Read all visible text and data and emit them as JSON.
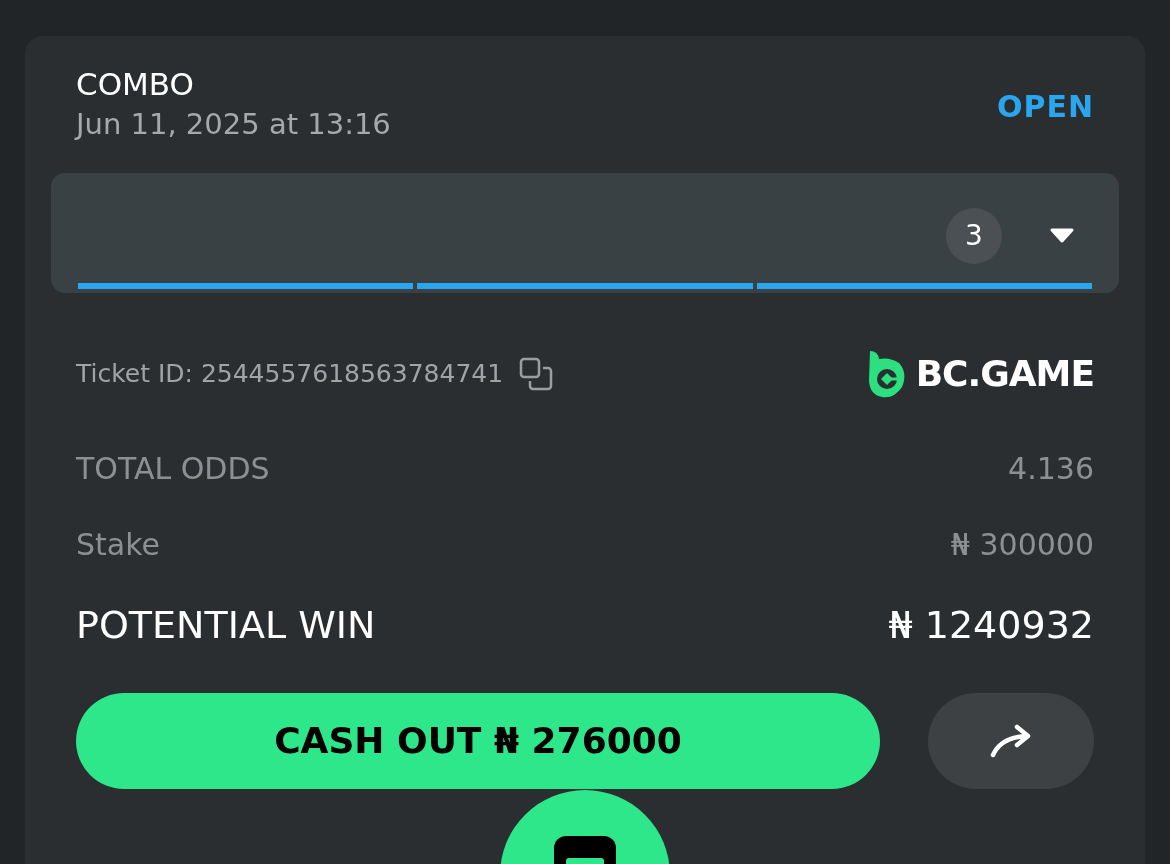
{
  "bet": {
    "type": "COMBO",
    "date": "Jun 11, 2025 at 13:16",
    "status": "OPEN"
  },
  "legs": {
    "count": "3",
    "expanded": false,
    "segments": [
      {
        "level": 1
      },
      {
        "level": 1
      },
      {
        "level": 1
      }
    ]
  },
  "ticket": {
    "label": "Ticket ID: 2544557618563784741",
    "brand": "BC.GAME"
  },
  "summary": [
    {
      "kind": "minor",
      "label": "TOTAL ODDS",
      "value": "4.136"
    },
    {
      "kind": "minor",
      "label": "Stake",
      "value": "₦ 300000"
    },
    {
      "kind": "major",
      "label": "POTENTIAL WIN",
      "value": "₦ 1240932"
    }
  ],
  "cash_out": {
    "label": "CASH OUT ₦ 276000"
  }
}
